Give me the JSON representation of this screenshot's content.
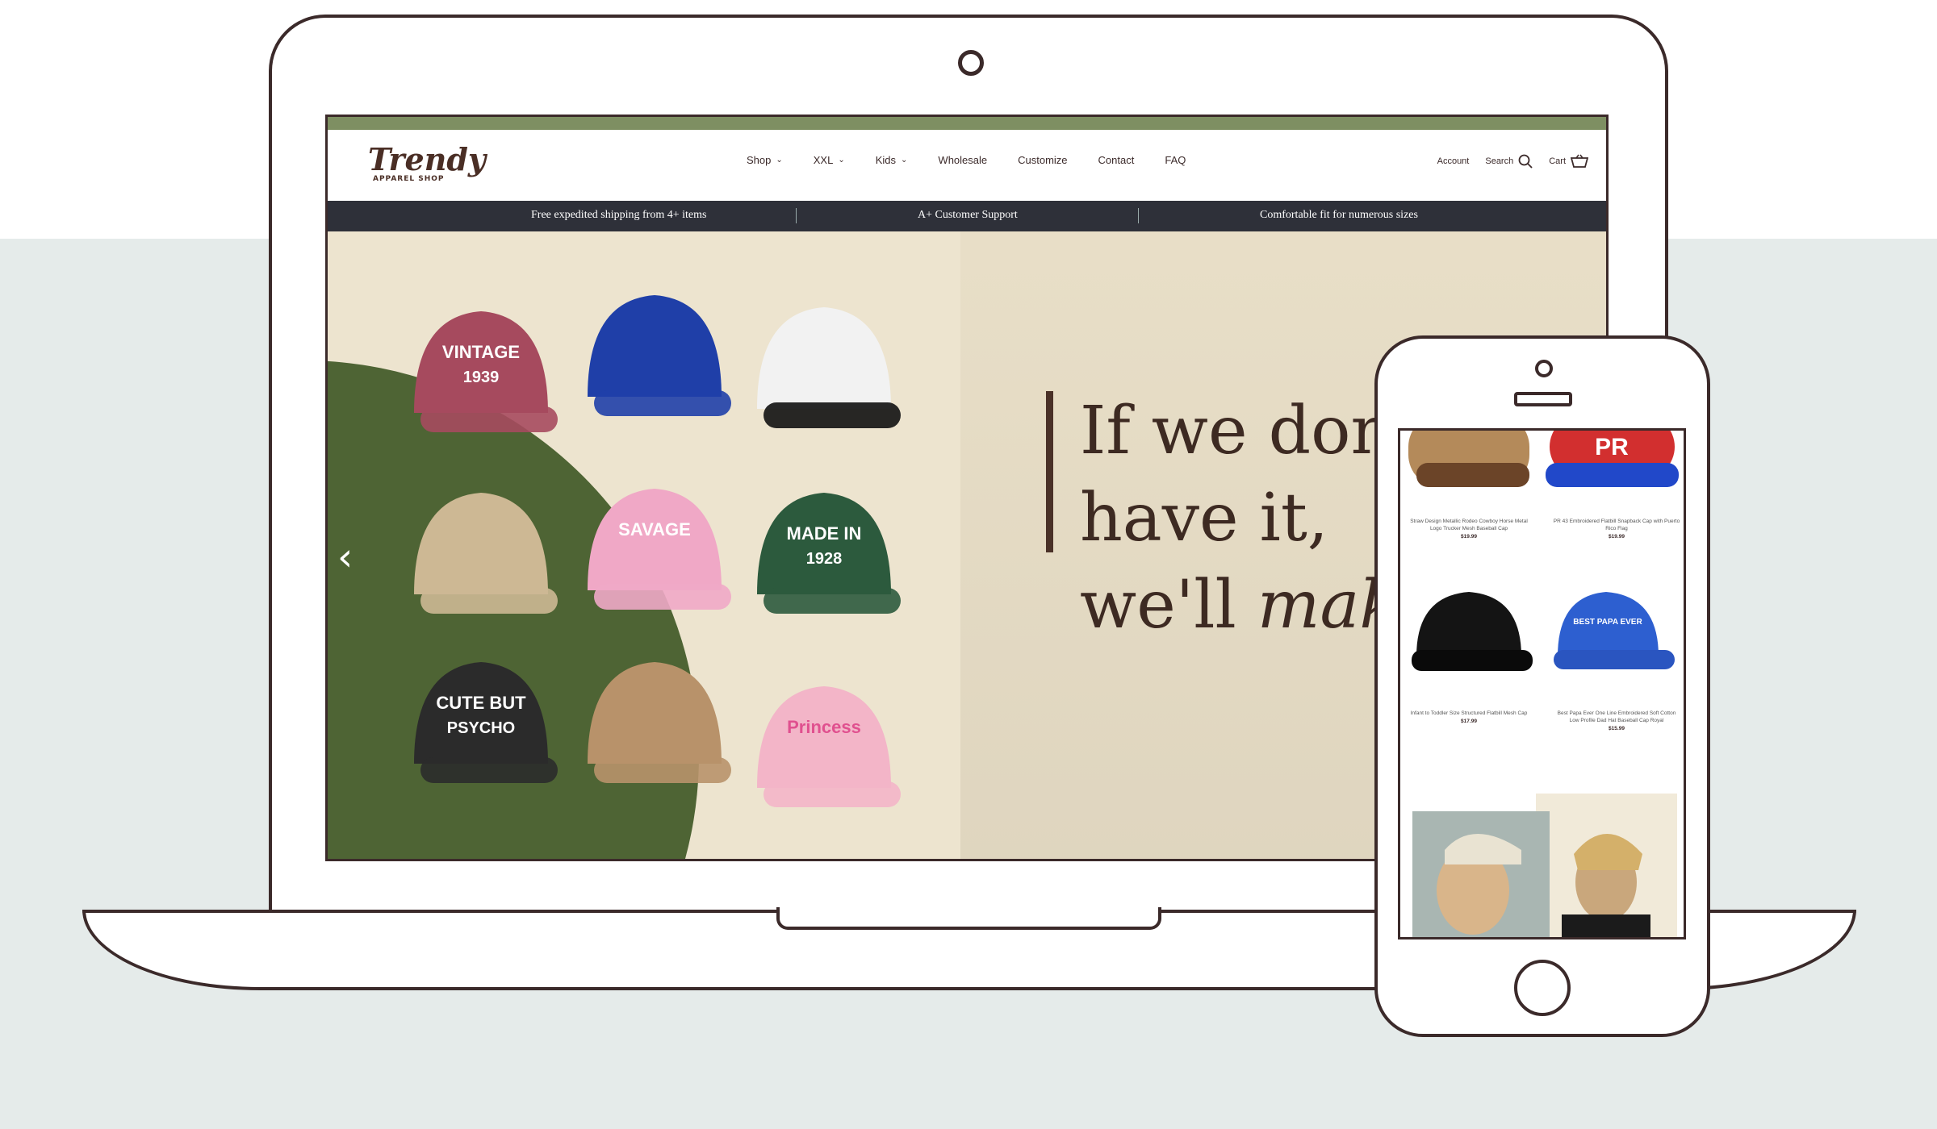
{
  "brand": {
    "name": "Trendy",
    "tagline": "APPAREL SHOP"
  },
  "nav": {
    "items": [
      {
        "label": "Shop",
        "dropdown": true
      },
      {
        "label": "XXL",
        "dropdown": true
      },
      {
        "label": "Kids",
        "dropdown": true
      },
      {
        "label": "Wholesale",
        "dropdown": false
      },
      {
        "label": "Customize",
        "dropdown": false
      },
      {
        "label": "Contact",
        "dropdown": false
      },
      {
        "label": "FAQ",
        "dropdown": false
      }
    ]
  },
  "utils": {
    "account": "Account",
    "search": "Search",
    "cart": "Cart"
  },
  "promo": {
    "items": [
      "Free expedited shipping from 4+ items",
      "A+ Customer Support",
      "Comfortable fit for numerous sizes"
    ]
  },
  "hero": {
    "line1": "If we don",
    "line2": "have it,",
    "line3_plain": "we'll ",
    "line3_italic": "mak",
    "caps": [
      {
        "text": "VINTAGE",
        "sub": "1939",
        "color": "#a64a5e"
      },
      {
        "text": "",
        "sub": "",
        "color": "#1f3fa8"
      },
      {
        "text": "",
        "sub": "",
        "color": "#f2f2f2"
      },
      {
        "text": "",
        "sub": "",
        "color": "#cdb894"
      },
      {
        "text": "SAVAGE",
        "sub": "",
        "color": "#f0a8c6"
      },
      {
        "text": "MADE IN",
        "sub": "1928",
        "color": "#2c5a3d"
      },
      {
        "text": "CUTE BUT",
        "sub": "PSYCHO",
        "color": "#2b2b2b"
      },
      {
        "text": "",
        "sub": "",
        "color": "#b8926a"
      },
      {
        "text": "Princess",
        "sub": "",
        "color": "#f3b5c8"
      }
    ]
  },
  "phone": {
    "products": [
      {
        "title": "Straw Design Metallic Rodeo Cowboy Horse Metal Logo Trucker Mesh Baseball Cap",
        "price": "$19.99"
      },
      {
        "title": "PR 43 Embroidered Flatbill Snapback Cap with Puerto Rico Flag",
        "price": "$19.99"
      },
      {
        "title": "Infant to Toddler Size Structured Flatbill Mesh Cap",
        "price": "$17.99"
      },
      {
        "title": "Best Papa Ever One Line Embroidered Soft Cotton Low Profile Dad Hat Baseball Cap Royal",
        "price": "$15.99"
      }
    ],
    "product_cap_text": "BEST PAPA EVER"
  },
  "colors": {
    "accent": "#7e8f62",
    "dark": "#2e3039",
    "brand": "#4a2e25",
    "hero_green": "#4e6434"
  }
}
